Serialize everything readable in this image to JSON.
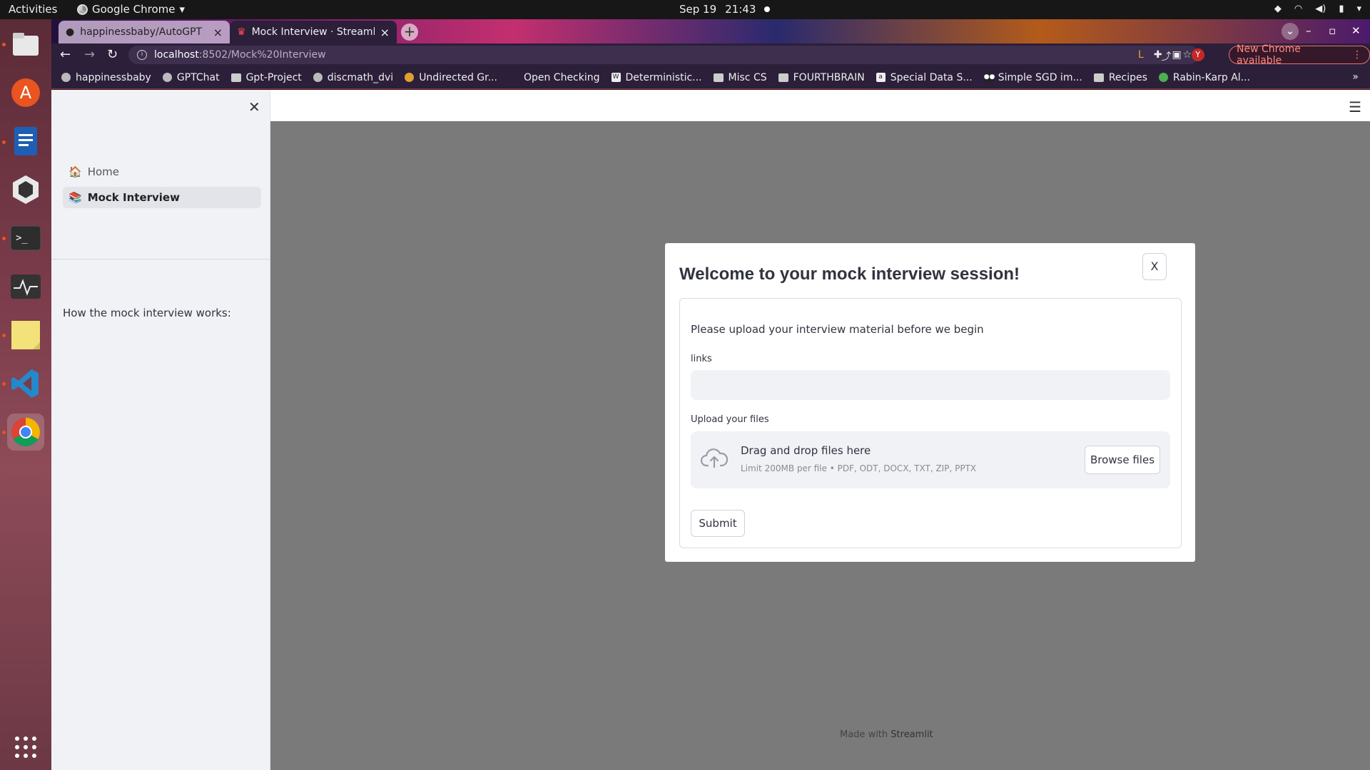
{
  "topbar": {
    "activities": "Activities",
    "app_name": "Google Chrome",
    "date": "Sep 19",
    "time": "21:43"
  },
  "dock": {
    "items": [
      "files-icon",
      "software-icon",
      "writer-icon",
      "unity-icon",
      "terminal-icon",
      "monitor-icon",
      "notes-icon",
      "vscode-icon",
      "chrome-icon",
      "apps-grid-icon"
    ]
  },
  "browser": {
    "tabs": [
      {
        "title": "happinessbaby/AutoGPT",
        "active": false
      },
      {
        "title": "Mock Interview · Streamlit",
        "active": true
      }
    ],
    "url_host": "localhost",
    "url_path": ":8502/Mock%20Interview",
    "update_label": "New Chrome available",
    "avatar_letter": "Y",
    "bookmarks": [
      "happinessbaby",
      "GPTChat",
      "Gpt-Project",
      "discmath_dvi",
      "Undirected Gr...",
      "Open Checking",
      "Deterministic...",
      "Misc CS",
      "FOURTHBRAIN",
      "Special Data S...",
      "Simple SGD im...",
      "Recipes",
      "Rabin-Karp Al..."
    ]
  },
  "sidebar": {
    "nav": [
      {
        "label": "Home",
        "icon": "🏠",
        "active": false
      },
      {
        "label": "Mock Interview",
        "icon": "📚",
        "active": true
      }
    ],
    "info_text": "How the mock interview works:"
  },
  "modal": {
    "title": "Welcome to your mock interview session!",
    "close_label": "X",
    "intro": "Please upload your interview material before we begin",
    "links_label": "links",
    "links_value": "",
    "upload_label": "Upload your files",
    "drop_title": "Drag and drop files here",
    "drop_limit": "Limit 200MB per file • PDF, ODT, DOCX, TXT, ZIP, PPTX",
    "browse_label": "Browse files",
    "submit_label": "Submit"
  },
  "footer": {
    "made_with": "Made with",
    "brand": "Streamlit"
  },
  "colors": {
    "overlay": "#7a7a7a",
    "sidebar_bg": "#f0f2f6",
    "text": "#31333f"
  }
}
